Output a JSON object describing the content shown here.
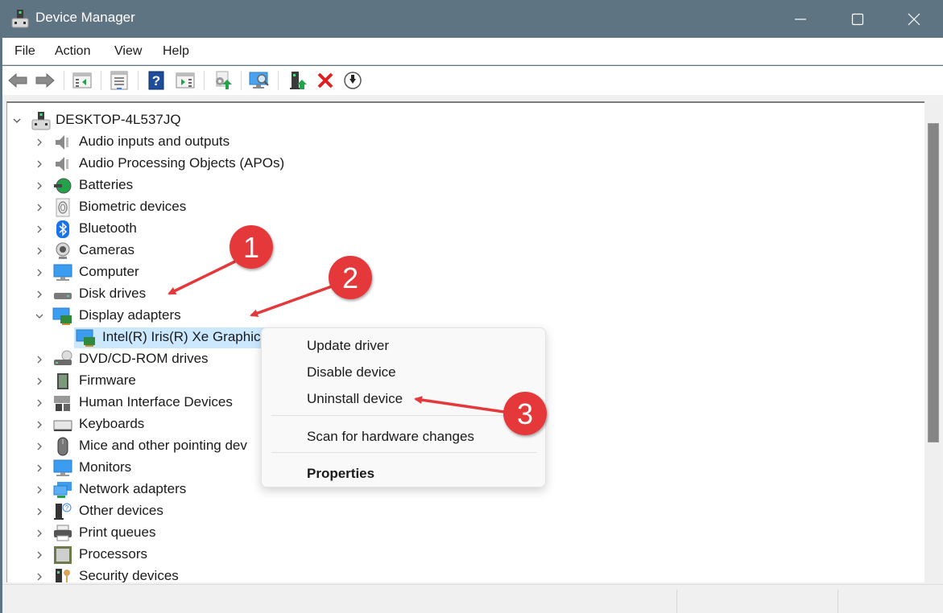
{
  "window": {
    "title": "Device Manager",
    "controls": {
      "minimize": "minimize",
      "maximize": "maximize",
      "close": "close"
    }
  },
  "menubar": {
    "items": [
      {
        "label": "File"
      },
      {
        "label": "Action"
      },
      {
        "label": "View"
      },
      {
        "label": "Help"
      }
    ]
  },
  "toolbar": {
    "buttons": [
      {
        "icon": "back-arrow-icon",
        "tooltip": "Back"
      },
      {
        "icon": "forward-arrow-icon",
        "tooltip": "Forward"
      },
      {
        "icon": "show-hide-console-tree-icon",
        "tooltip": "Show/Hide Console Tree"
      },
      {
        "icon": "properties-icon",
        "tooltip": "Properties"
      },
      {
        "icon": "help-icon",
        "tooltip": "Help"
      },
      {
        "icon": "show-hide-action-pane-icon",
        "tooltip": "Show/Hide Action Pane"
      },
      {
        "icon": "update-driver-icon",
        "tooltip": "Update Driver"
      },
      {
        "icon": "scan-hardware-icon",
        "tooltip": "Scan for hardware changes"
      },
      {
        "icon": "add-legacy-hardware-icon",
        "tooltip": "Add legacy hardware"
      },
      {
        "icon": "uninstall-icon",
        "tooltip": "Uninstall device"
      },
      {
        "icon": "disable-device-icon",
        "tooltip": "Disable device"
      }
    ]
  },
  "tree": {
    "root": {
      "label": "DESKTOP-4L537JQ",
      "expanded": true,
      "icon": "computer-tower-icon"
    },
    "categories": [
      {
        "label": "Audio inputs and outputs",
        "icon": "speaker-icon",
        "expanded": false
      },
      {
        "label": "Audio Processing Objects (APOs)",
        "icon": "speaker-icon",
        "expanded": false
      },
      {
        "label": "Batteries",
        "icon": "battery-icon",
        "expanded": false
      },
      {
        "label": "Biometric devices",
        "icon": "fingerprint-icon",
        "expanded": false
      },
      {
        "label": "Bluetooth",
        "icon": "bluetooth-icon",
        "expanded": false
      },
      {
        "label": "Cameras",
        "icon": "webcam-icon",
        "expanded": false
      },
      {
        "label": "Computer",
        "icon": "monitor-icon",
        "expanded": false
      },
      {
        "label": "Disk drives",
        "icon": "disk-drive-icon",
        "expanded": false
      },
      {
        "label": "Display adapters",
        "icon": "display-adapter-icon",
        "expanded": true,
        "children": [
          {
            "label": "Intel(R) Iris(R) Xe Graphics",
            "icon": "display-adapter-icon",
            "selected": true
          }
        ]
      },
      {
        "label": "DVD/CD-ROM drives",
        "icon": "dvd-drive-icon",
        "expanded": false
      },
      {
        "label": "Firmware",
        "icon": "chip-icon",
        "expanded": false
      },
      {
        "label": "Human Interface Devices",
        "icon": "hid-icon",
        "expanded": false
      },
      {
        "label": "Keyboards",
        "icon": "keyboard-icon",
        "expanded": false
      },
      {
        "label": "Mice and other pointing dev",
        "icon": "mouse-icon",
        "expanded": false
      },
      {
        "label": "Monitors",
        "icon": "monitor-icon",
        "expanded": false
      },
      {
        "label": "Network adapters",
        "icon": "network-icon",
        "expanded": false
      },
      {
        "label": "Other devices",
        "icon": "unknown-device-icon",
        "expanded": false
      },
      {
        "label": "Print queues",
        "icon": "printer-icon",
        "expanded": false
      },
      {
        "label": "Processors",
        "icon": "processor-icon",
        "expanded": false
      },
      {
        "label": "Security devices",
        "icon": "security-key-icon",
        "expanded": false
      }
    ]
  },
  "context_menu": {
    "items": [
      {
        "label": "Update driver",
        "bold": false
      },
      {
        "label": "Disable device",
        "bold": false
      },
      {
        "label": "Uninstall device",
        "bold": false
      },
      {
        "label": "Scan for hardware changes",
        "bold": false
      },
      {
        "label": "Properties",
        "bold": true
      }
    ]
  },
  "annotations": {
    "badges": [
      {
        "number": "1",
        "target": "Display adapters"
      },
      {
        "number": "2",
        "target": "Intel(R) Iris(R) Xe Graphics"
      },
      {
        "number": "3",
        "target": "Uninstall device"
      }
    ],
    "color": "#e5383b"
  },
  "colors": {
    "titlebar": "#5f7482",
    "selection": "#cce8ff",
    "annotation_red": "#e5383b"
  }
}
